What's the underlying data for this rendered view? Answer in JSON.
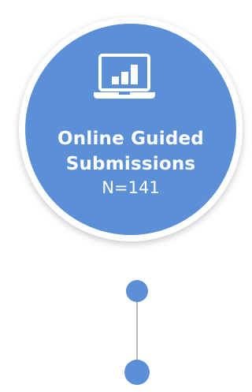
{
  "card": {
    "title_line1": "Online Guided",
    "title_line2": "Submissions",
    "count": "N=141"
  },
  "icons": {
    "main": "laptop-chart-icon"
  },
  "colors": {
    "accent": "#5b8fd6",
    "connector": "#b8b8b8",
    "text": "#ffffff"
  }
}
